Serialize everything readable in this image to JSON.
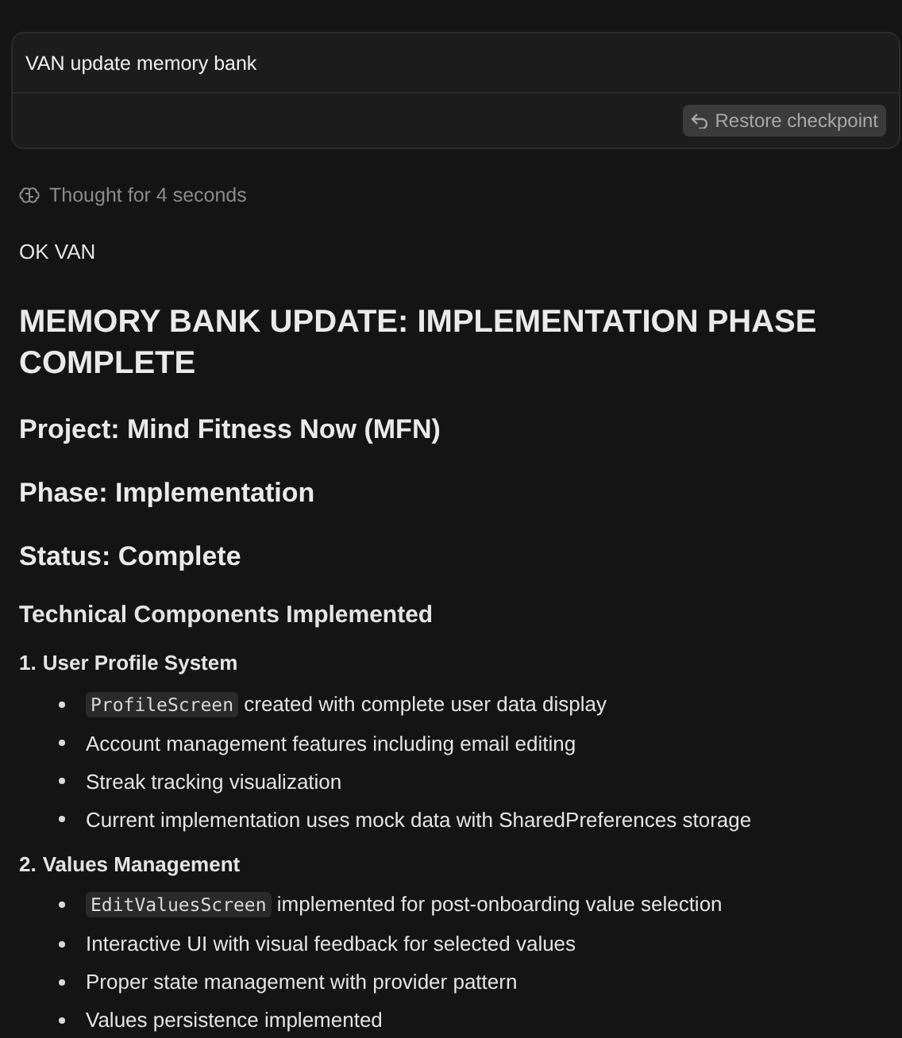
{
  "prompt": {
    "text": "VAN update memory bank",
    "restore_button": "Restore checkpoint"
  },
  "thought": "Thought for 4 seconds",
  "reply": "OK VAN",
  "title": "MEMORY BANK UPDATE: IMPLEMENTATION PHASE COMPLETE",
  "subheadings": [
    "Project: Mind Fitness Now (MFN)",
    "Phase: Implementation",
    "Status: Complete"
  ],
  "section": "Technical Components Implemented",
  "components": [
    {
      "number": "1.",
      "name": "User Profile System",
      "items": [
        {
          "code": "ProfileScreen",
          "text": " created with complete user data display"
        },
        {
          "text": "Account management features including email editing"
        },
        {
          "text": "Streak tracking visualization"
        },
        {
          "text": "Current implementation uses mock data with SharedPreferences storage"
        }
      ]
    },
    {
      "number": "2.",
      "name": "Values Management",
      "items": [
        {
          "code": "EditValuesScreen",
          "text": " implemented for post-onboarding value selection"
        },
        {
          "text": "Interactive UI with visual feedback for selected values"
        },
        {
          "text": "Proper state management with provider pattern"
        },
        {
          "text": "Values persistence implemented"
        }
      ]
    }
  ]
}
